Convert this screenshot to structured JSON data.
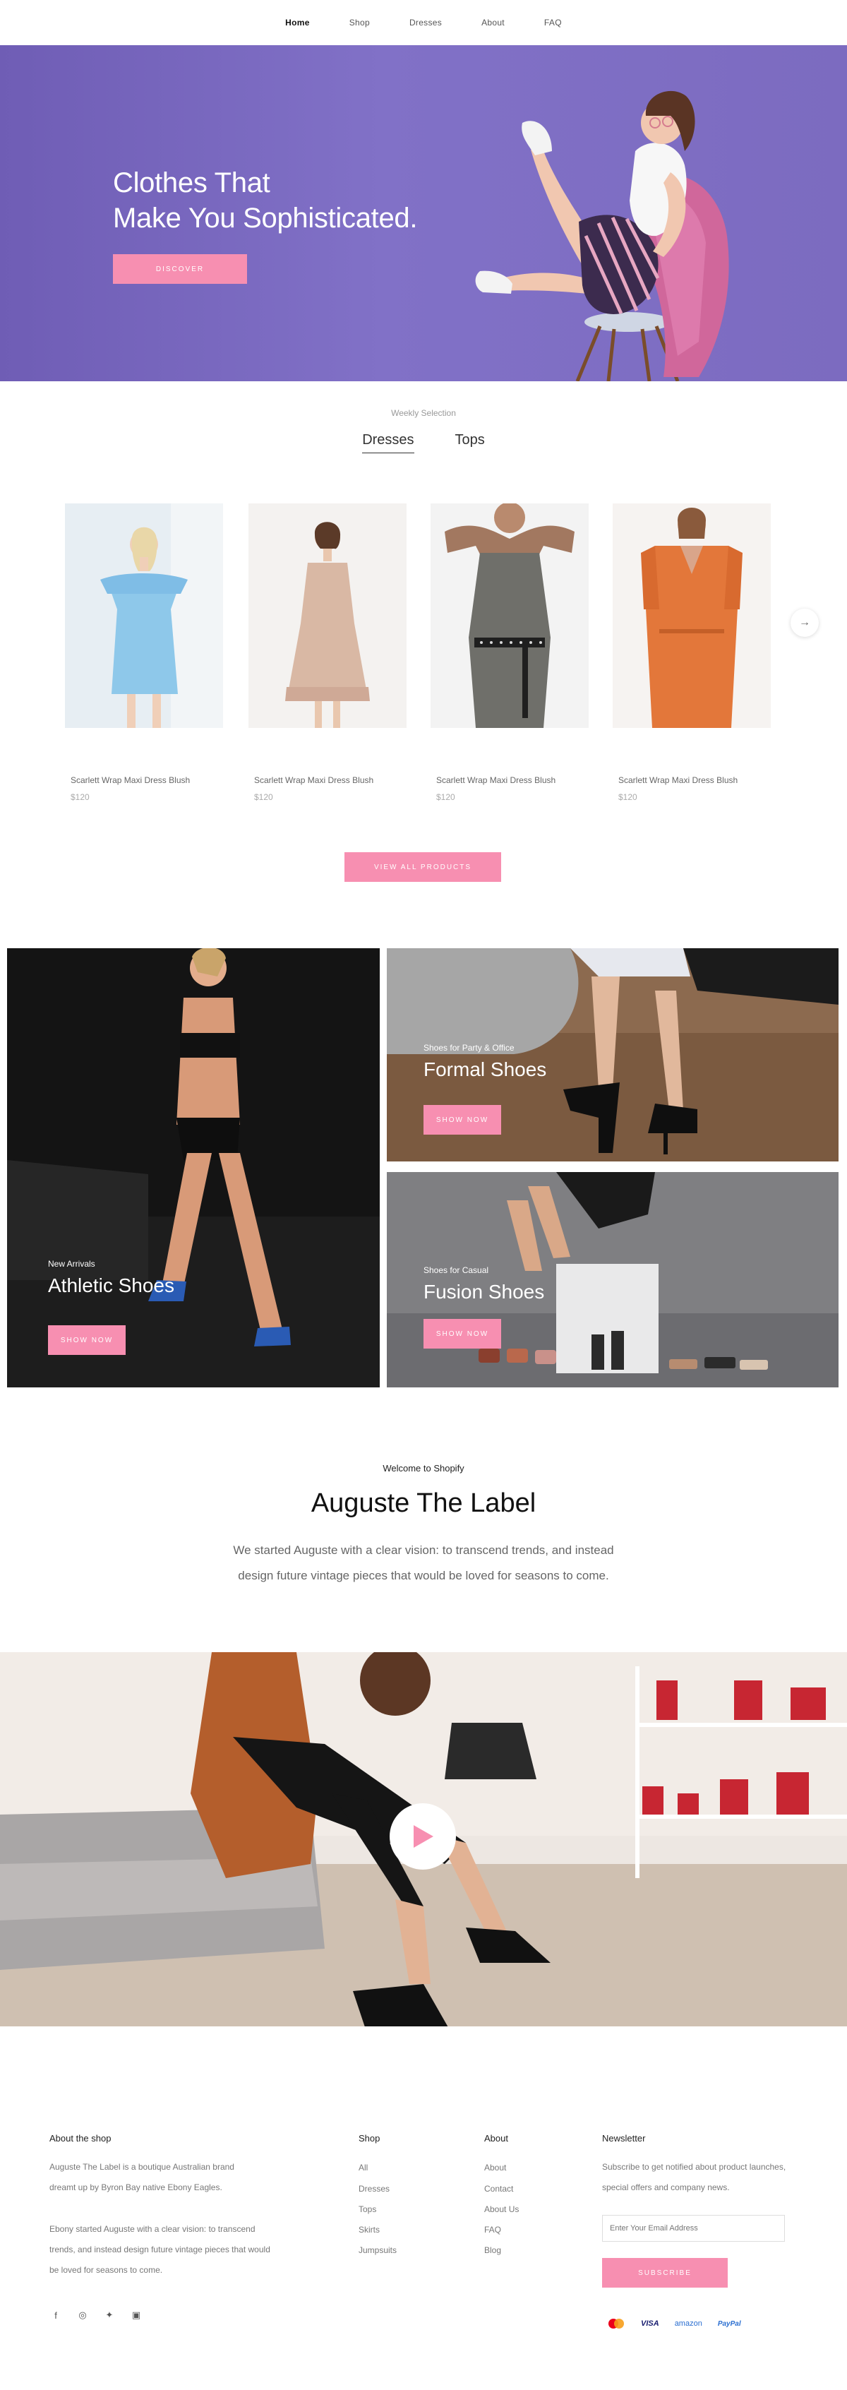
{
  "nav": {
    "items": [
      "Home",
      "Shop",
      "Dresses",
      "About",
      "FAQ"
    ]
  },
  "hero": {
    "title_line1": "Clothes That",
    "title_line2": "Make You Sophisticated.",
    "button": "DISCOVER"
  },
  "weekly": {
    "label": "Weekly Selection",
    "tabs": [
      "Dresses",
      "Tops"
    ],
    "products": [
      {
        "name": "Scarlett Wrap Maxi Dress Blush",
        "price": "$120"
      },
      {
        "name": "Scarlett Wrap Maxi Dress Blush",
        "price": "$120"
      },
      {
        "name": "Scarlett Wrap Maxi Dress Blush",
        "price": "$120"
      },
      {
        "name": "Scarlett Wrap Maxi Dress Blush",
        "price": "$120"
      }
    ],
    "view_all": "VIEW ALL PRODUCTS"
  },
  "banners": {
    "athletic": {
      "small": "New Arrivals",
      "big": "Athletic Shoes",
      "button": "Show Now"
    },
    "formal": {
      "small": "Shoes for Party & Office",
      "big": "Formal Shoes",
      "button": "Show Now"
    },
    "fusion": {
      "small": "Shoes for Casual",
      "big": "Fusion Shoes",
      "button": "Show Now"
    }
  },
  "about": {
    "welcome": "Welcome to Shopify",
    "title": "Auguste The Label",
    "desc": "We started Auguste with a clear vision: to transcend trends, and instead design future vintage pieces that would be loved for seasons to come."
  },
  "footer": {
    "about_head": "About the shop",
    "about_p1": "Auguste The Label is a boutique Australian brand dreamt up by Byron Bay native Ebony Eagles.",
    "about_p2": "Ebony started Auguste with a clear vision: to transcend trends, and instead design future vintage pieces that would be loved for seasons to come.",
    "shop_head": "Shop",
    "shop_links": [
      "All",
      "Dresses",
      "Tops",
      "Skirts",
      "Jumpsuits"
    ],
    "about_col_head": "About",
    "about_links": [
      "About",
      "Contact",
      "About Us",
      "FAQ",
      "Blog"
    ],
    "news_head": "Newsletter",
    "news_text": "Subscribe to get notified about product launches, special offers and company news.",
    "email_placeholder": "Enter Your Email Address",
    "subscribe": "SUBSCRIBE",
    "payments": [
      "VISA",
      "amazon",
      "PayPal"
    ]
  },
  "colors": {
    "accent": "#f78fb1",
    "hero_bg": "#7a68c1"
  }
}
